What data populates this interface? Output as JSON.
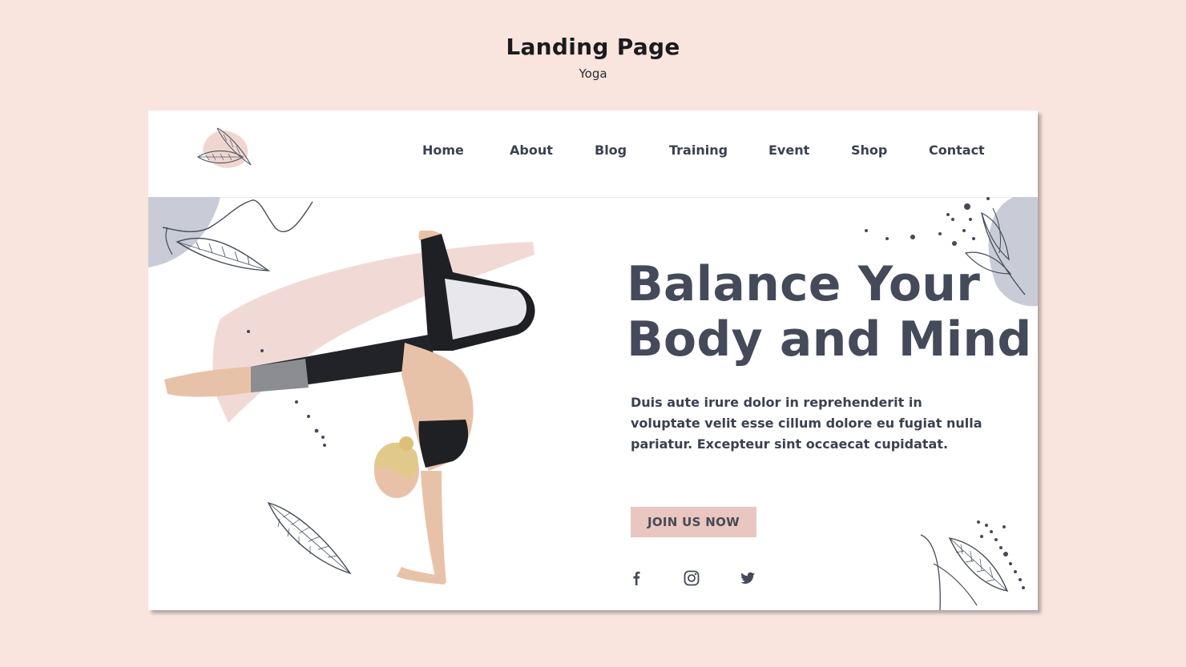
{
  "page": {
    "title": "Landing Page",
    "subtitle": "Yoga"
  },
  "nav": {
    "items": [
      {
        "label": "Home",
        "name": "nav-home"
      },
      {
        "label": "About",
        "name": "nav-about"
      },
      {
        "label": "Blog",
        "name": "nav-blog"
      },
      {
        "label": "Training",
        "name": "nav-training"
      },
      {
        "label": "Event",
        "name": "nav-event"
      },
      {
        "label": "Shop",
        "name": "nav-shop"
      },
      {
        "label": "Contact",
        "name": "nav-contact"
      }
    ]
  },
  "hero": {
    "title_line1": "Balance Your",
    "title_line2": "Body and Mind",
    "body": "Duis aute irure dolor in reprehenderit in voluptate velit esse cillum dolore eu fugiat nulla pariatur. Excepteur sint occaecat cupidatat.",
    "cta": "JOIN US NOW"
  },
  "social": [
    {
      "icon": "facebook-icon"
    },
    {
      "icon": "instagram-icon"
    },
    {
      "icon": "twitter-icon"
    }
  ],
  "colors": {
    "background": "#f9e4de",
    "card": "#ffffff",
    "text_dark": "#444a59",
    "button": "#e9c6c0",
    "blob": "#c9ccd6",
    "brush": "#efd6d0"
  }
}
